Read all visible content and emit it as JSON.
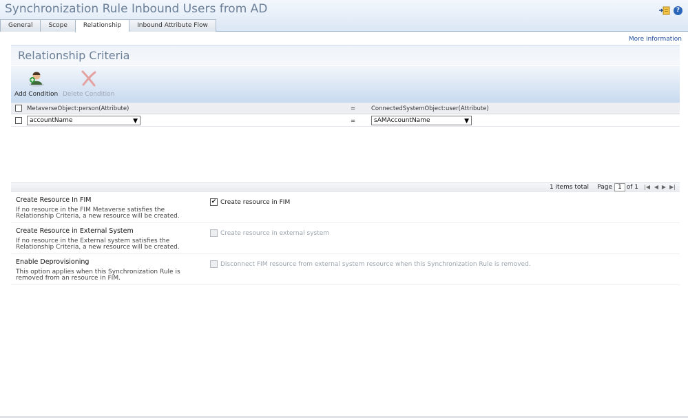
{
  "window": {
    "title": "Synchronization Rule Inbound Users from AD"
  },
  "tabs": [
    {
      "label": "General",
      "active": false
    },
    {
      "label": "Scope",
      "active": false
    },
    {
      "label": "Relationship",
      "active": true
    },
    {
      "label": "Inbound Attribute Flow",
      "active": false
    }
  ],
  "links": {
    "more_info": "More information"
  },
  "panel": {
    "title": "Relationship Criteria",
    "add_condition": "Add Condition",
    "delete_condition": "Delete Condition"
  },
  "grid": {
    "left_header": "MetaverseObject:person(Attribute)",
    "operator_header": "=",
    "right_header": "ConnectedSystemObject:user(Attribute)",
    "rows": [
      {
        "left_value": "accountName",
        "operator": "=",
        "right_value": "sAMAccountName"
      }
    ]
  },
  "pager": {
    "total": "1 items total",
    "page_label": "Page",
    "page_value": "1",
    "of_label": "of 1"
  },
  "options": [
    {
      "title": "Create Resource In FIM",
      "description": "If no resource in the FIM Metaverse satisfies the Relationship Criteria, a new resource will be created.",
      "checkbox_label": "Create resource in FIM",
      "checked": true,
      "enabled": true
    },
    {
      "title": "Create Resource in External System",
      "description": "If no resource in the External system satisfies the Relationship Criteria, a new resource will be created.",
      "checkbox_label": "Create resource in external system",
      "checked": false,
      "enabled": false
    },
    {
      "title": "Enable Deprovisioning",
      "description": "This option applies when this Synchronization Rule is removed from an resource in FIM.",
      "checkbox_label": "Disconnect FIM resource from external system resource when this Synchronization Rule is removed.",
      "checked": false,
      "enabled": false
    }
  ],
  "icons": {
    "export": "export-icon",
    "help": "help-icon",
    "add_condition": "add-user-icon",
    "delete_condition": "delete-x-icon",
    "pager_first": "first-page-icon",
    "pager_prev": "prev-page-icon",
    "pager_next": "next-page-icon",
    "pager_last": "last-page-icon"
  },
  "colors": {
    "title": "#6b7f98",
    "link": "#1f4f9e",
    "help": "#2a66b8",
    "delete_icon": "#e5a0a0"
  }
}
